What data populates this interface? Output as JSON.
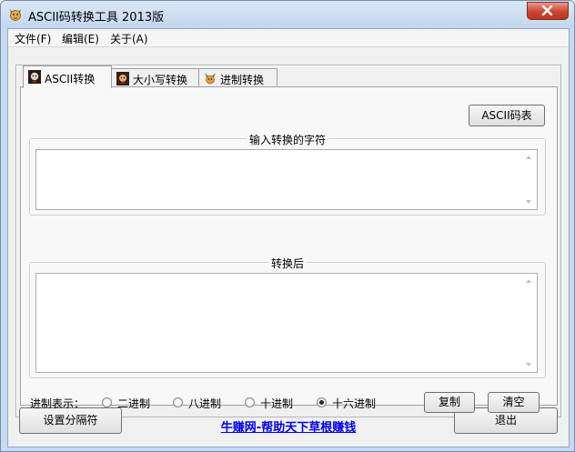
{
  "window": {
    "title": "ASCII码转换工具 2013版",
    "icon": "app-icon",
    "close_icon": "close-icon"
  },
  "menu": {
    "items": [
      {
        "label": "文件(F)"
      },
      {
        "label": "编辑(E)"
      },
      {
        "label": "关于(A)"
      }
    ]
  },
  "tabs": [
    {
      "label": "ASCII转换",
      "icon": "character-icon",
      "active": true
    },
    {
      "label": "大小写转换",
      "icon": "character-icon",
      "active": false
    },
    {
      "label": "进制转换",
      "icon": "character-icon",
      "active": false
    }
  ],
  "ascii_panel": {
    "ascii_table_button": "ASCII码表",
    "input_group_label": "输入转换的字符",
    "input_value": "",
    "output_group_label": "转换后",
    "output_value": "",
    "base_label": "进制表示：",
    "radios": [
      {
        "label": "二进制",
        "selected": false
      },
      {
        "label": "八进制",
        "selected": false
      },
      {
        "label": "十进制",
        "selected": false
      },
      {
        "label": "十六进制",
        "selected": true
      }
    ],
    "copy_button": "复制",
    "clear_button": "清空"
  },
  "footer": {
    "separator_button": "设置分隔符",
    "link_text": "牛赚网-帮助天下草根赚钱",
    "exit_button": "退出"
  },
  "colors": {
    "title_bar": "#c9daf0",
    "close_button": "#c9452d",
    "link": "#0000ee"
  }
}
